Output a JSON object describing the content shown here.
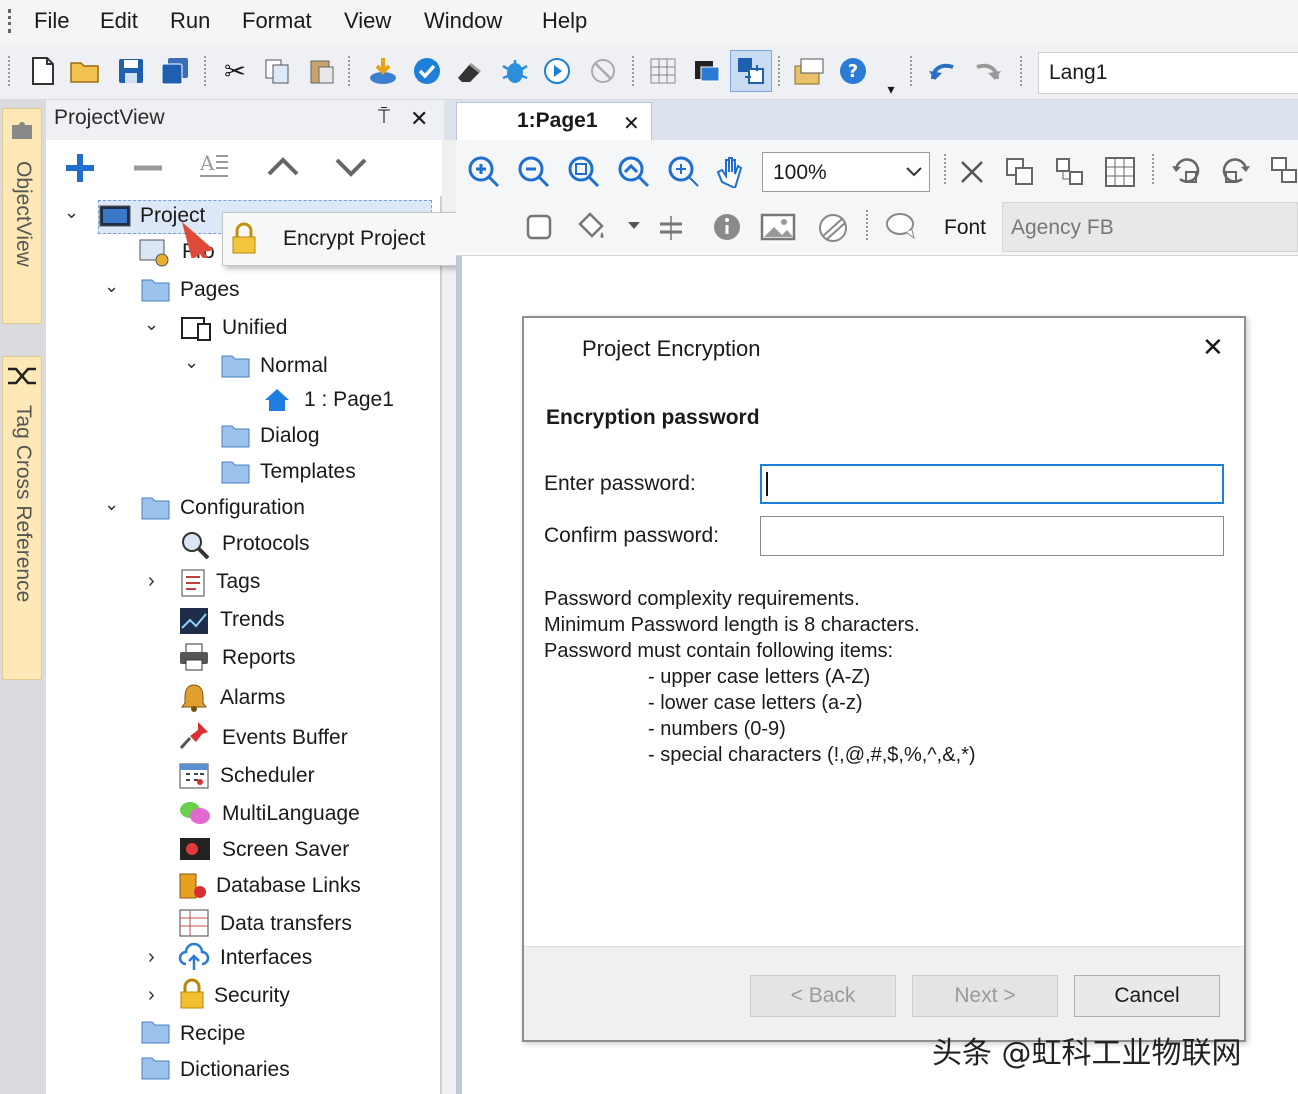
{
  "menu": {
    "items": [
      "File",
      "Edit",
      "Run",
      "Format",
      "View",
      "Window",
      "Help"
    ]
  },
  "toolbar": {
    "language_value": "Lang1"
  },
  "side_tabs": {
    "object_view": "ObjectView",
    "tag_cross_reference": "Tag Cross Reference"
  },
  "project_view": {
    "title": "ProjectView",
    "pin_glyph": "⍑",
    "close_glyph": "✕"
  },
  "tree": {
    "project": "Project",
    "project_child": "Pro",
    "pages": "Pages",
    "unified": "Unified",
    "normal": "Normal",
    "page1": "1 : Page1",
    "dialog": "Dialog",
    "templates": "Templates",
    "configuration": "Configuration",
    "protocols": "Protocols",
    "tags": "Tags",
    "trends": "Trends",
    "reports": "Reports",
    "alarms": "Alarms",
    "events_buffer": "Events Buffer",
    "scheduler": "Scheduler",
    "multilanguage": "MultiLanguage",
    "screen_saver": "Screen Saver",
    "database_links": "Database Links",
    "data_transfers": "Data transfers",
    "interfaces": "Interfaces",
    "security": "Security",
    "recipe": "Recipe",
    "dictionaries": "Dictionaries"
  },
  "context_menu": {
    "encrypt_project": "Encrypt Project"
  },
  "document": {
    "tab_label": "1:Page1",
    "tab_close": "✕",
    "zoom_value": "100%",
    "font_label": "Font",
    "font_value": "Agency FB"
  },
  "dialog": {
    "title": "Project Encryption",
    "close_glyph": "✕",
    "section_heading": "Encryption password",
    "enter_label": "Enter password:",
    "confirm_label": "Confirm password:",
    "enter_value": "",
    "confirm_value": "",
    "req_line1": "Password complexity requirements.",
    "req_line2": "Minimum Password length is 8 characters.",
    "req_line3": "Password must contain following items:",
    "req_items": [
      "- upper case letters (A-Z)",
      "- lower case letters (a-z)",
      "- numbers (0-9)",
      "- special characters (!,@,#,$,%,^,&,*)"
    ],
    "back_label": "< Back",
    "next_label": "Next >",
    "cancel_label": "Cancel"
  },
  "watermark": "头条 @虹科工业物联网"
}
